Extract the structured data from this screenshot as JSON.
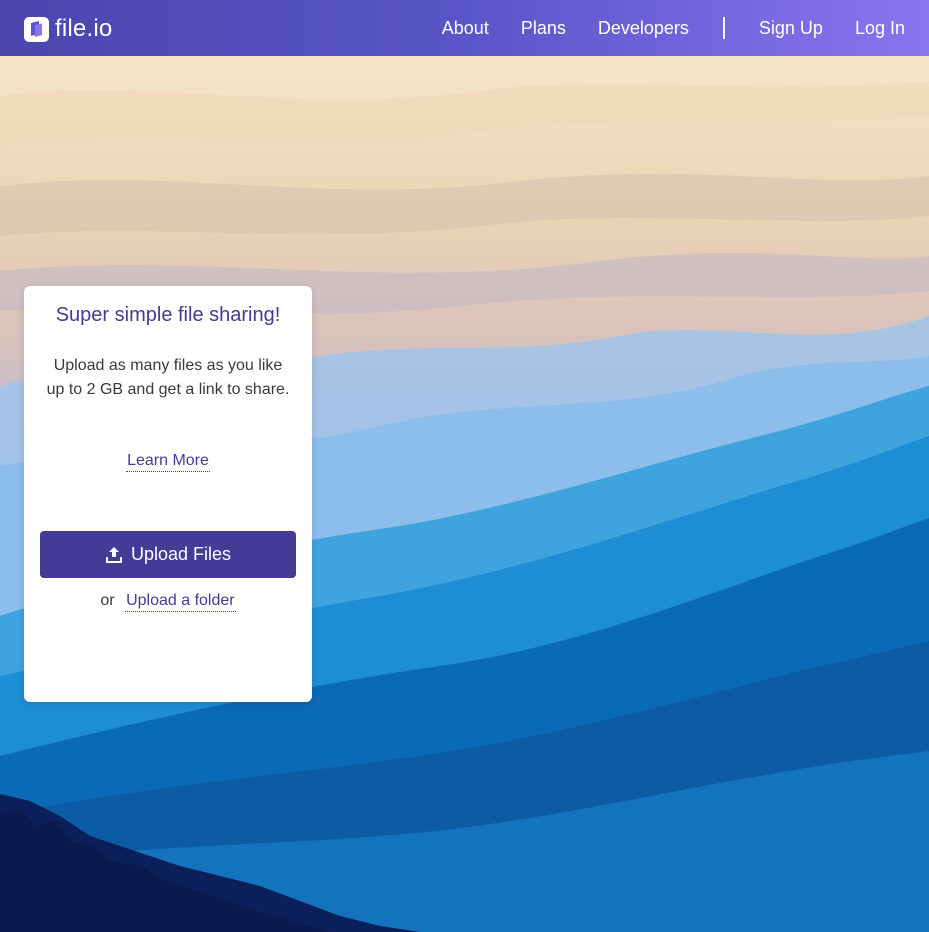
{
  "header": {
    "logo_text": "file.io",
    "nav": {
      "about": "About",
      "plans": "Plans",
      "developers": "Developers",
      "sign_up": "Sign Up",
      "log_in": "Log In"
    }
  },
  "card": {
    "title": "Super simple file sharing!",
    "description": "Upload as many files as you like up to 2 GB and get a link to share.",
    "learn_more": "Learn More",
    "upload_button": "Upload Files",
    "or_text": "or",
    "upload_folder": "Upload a folder"
  },
  "colors": {
    "accent": "#433b96",
    "header_start": "#4b45ad",
    "header_end": "#8a74f0"
  },
  "icons": {
    "logo": "file-io-logo-icon",
    "upload": "upload-icon"
  }
}
